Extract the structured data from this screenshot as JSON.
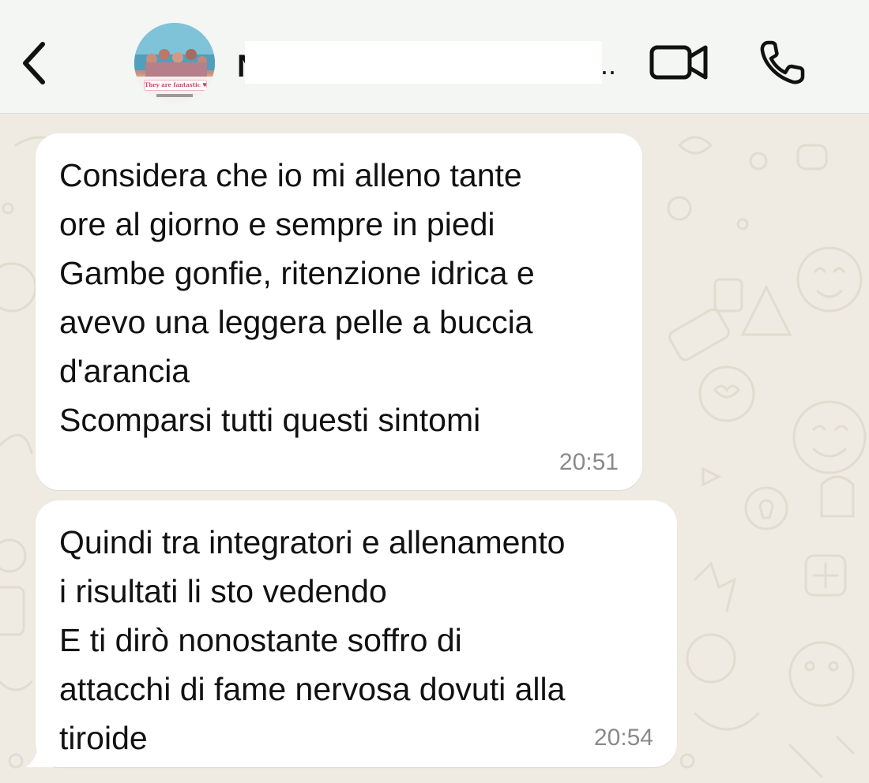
{
  "header": {
    "back_icon": "chevron-left-icon",
    "avatar_banner": "They are fantastic ♥",
    "contact_initial": "N",
    "name_ellipsis": "..",
    "video_icon": "video-camera-icon",
    "call_icon": "phone-icon"
  },
  "messages": [
    {
      "text": "Considera che io mi alleno tante\nore al giorno e sempre in piedi\nGambe gonfie, ritenzione idrica e\navevo una leggera pelle a buccia\nd'arancia\nScomparsi tutti questi sintomi",
      "time": "20:51"
    },
    {
      "text": "Quindi tra integratori e allenamento\ni risultati li sto vedendo\nE ti dirò nonostante soffro di\nattacchi di fame nervosa dovuti alla\ntiroide",
      "time": "20:54"
    }
  ],
  "colors": {
    "header_bg": "#f3f6f2",
    "chat_bg": "#efeae2",
    "bubble_bg": "#ffffff",
    "text": "#111111",
    "time": "#8a8a8a"
  }
}
